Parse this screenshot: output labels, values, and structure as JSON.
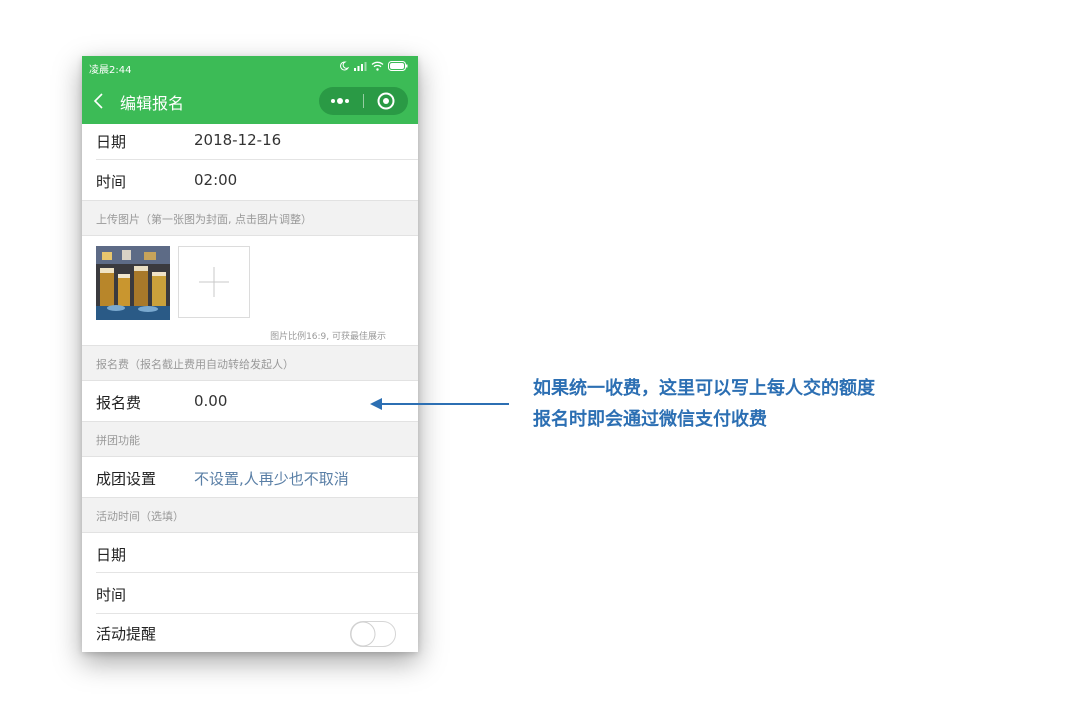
{
  "status_bar": {
    "time": "凌晨2:44"
  },
  "nav": {
    "title": "编辑报名"
  },
  "fields": {
    "date_label": "日期",
    "date_value": "2018-12-16",
    "time_label": "时间",
    "time_value": "02:00",
    "upload_section": "上传图片（第一张图为封面, 点击图片调整）",
    "ratio_hint": "图片比例16:9, 可获最佳展示",
    "fee_section": "报名费（报名截止费用自动转给发起人）",
    "fee_label": "报名费",
    "fee_value": "0.00",
    "group_section": "拼团功能",
    "group_label": "成团设置",
    "group_value": "不设置,人再少也不取消",
    "activity_section": "活动时间（选填）",
    "activity_date_label": "日期",
    "activity_time_label": "时间",
    "reminder_label": "活动提醒",
    "reminder_on": false
  },
  "callout": {
    "line1": "如果统一收费，这里可以写上每人交的额度",
    "line2": "报名时即会通过微信支付收费"
  },
  "colors": {
    "header": "#3cbb56",
    "capsule": "#2a9a45",
    "link": "#5a7fa6",
    "callout": "#2c6fb3"
  },
  "icons": [
    "back-icon",
    "more-icon",
    "close-icon",
    "plus-icon",
    "moon-icon",
    "signal-icon",
    "wifi-icon",
    "battery-icon"
  ]
}
